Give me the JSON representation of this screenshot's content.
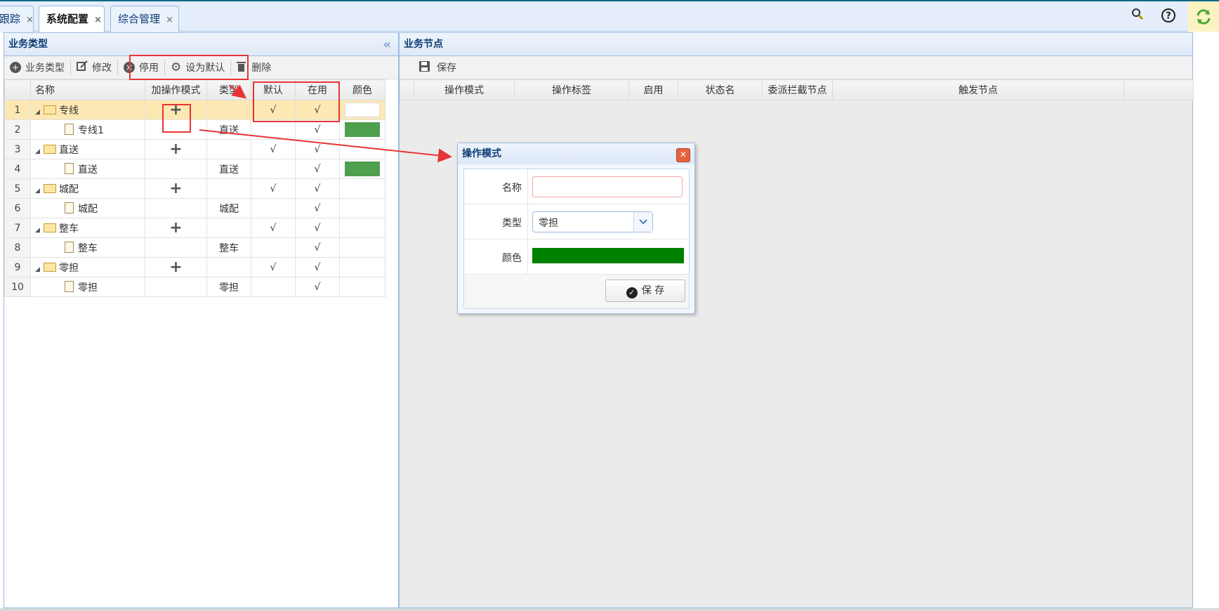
{
  "tabs": [
    {
      "label": "跟踪",
      "close": "×"
    },
    {
      "label": "系统配置",
      "close": "×",
      "active": true
    },
    {
      "label": "综合管理",
      "close": "×"
    }
  ],
  "top_icons": [
    "search-icon",
    "help-icon",
    "refresh-icon"
  ],
  "left_panel": {
    "title": "业务类型",
    "collapse_glyph": "«",
    "toolbar": [
      {
        "label": "业务类型",
        "icon": "add-icon"
      },
      {
        "label": "修改",
        "icon": "edit-icon"
      },
      {
        "label": "停用",
        "icon": "stop-icon"
      },
      {
        "label": "设为默认",
        "icon": "gear-icon"
      },
      {
        "label": "删除",
        "icon": "trash-icon"
      }
    ],
    "columns": [
      "名称",
      "加操作模式",
      "类型",
      "默认",
      "在用",
      "颜色"
    ],
    "rows": [
      {
        "num": "1",
        "name": "专线",
        "kind": "folder",
        "add": "+",
        "type": "",
        "default": "√",
        "inuse": "√",
        "color": ""
      },
      {
        "num": "2",
        "name": "专线1",
        "kind": "leaf",
        "add": "",
        "type": "直送",
        "default": "",
        "inuse": "√",
        "color": "#4e9f4e"
      },
      {
        "num": "3",
        "name": "直送",
        "kind": "folder",
        "add": "+",
        "type": "",
        "default": "√",
        "inuse": "√",
        "color": ""
      },
      {
        "num": "4",
        "name": "直送",
        "kind": "leaf",
        "add": "",
        "type": "直送",
        "default": "",
        "inuse": "√",
        "color": "#4e9f4e"
      },
      {
        "num": "5",
        "name": "城配",
        "kind": "folder",
        "add": "+",
        "type": "",
        "default": "√",
        "inuse": "√",
        "color": ""
      },
      {
        "num": "6",
        "name": "城配",
        "kind": "leaf",
        "add": "",
        "type": "城配",
        "default": "",
        "inuse": "√",
        "color": ""
      },
      {
        "num": "7",
        "name": "整车",
        "kind": "folder",
        "add": "+",
        "type": "",
        "default": "√",
        "inuse": "√",
        "color": ""
      },
      {
        "num": "8",
        "name": "整车",
        "kind": "leaf",
        "add": "",
        "type": "整车",
        "default": "",
        "inuse": "√",
        "color": ""
      },
      {
        "num": "9",
        "name": "零担",
        "kind": "folder",
        "add": "+",
        "type": "",
        "default": "√",
        "inuse": "√",
        "color": ""
      },
      {
        "num": "10",
        "name": "零担",
        "kind": "leaf",
        "add": "",
        "type": "零担",
        "default": "",
        "inuse": "√",
        "color": ""
      }
    ]
  },
  "right_panel": {
    "title": "业务节点",
    "save_label": "保存",
    "columns": [
      "操作模式",
      "操作标签",
      "启用",
      "状态名",
      "委派拦截节点",
      "触发节点"
    ]
  },
  "dialog": {
    "title": "操作模式",
    "close": "✕",
    "name_label": "名称",
    "name_value": "",
    "type_label": "类型",
    "type_value": "零担",
    "color_label": "颜色",
    "color_value": "#008000",
    "save_label": "保 存"
  },
  "colors": {
    "accent_red": "#e83434",
    "selected_row": "#fbe8b3",
    "header_blue": "#0b3c73"
  }
}
